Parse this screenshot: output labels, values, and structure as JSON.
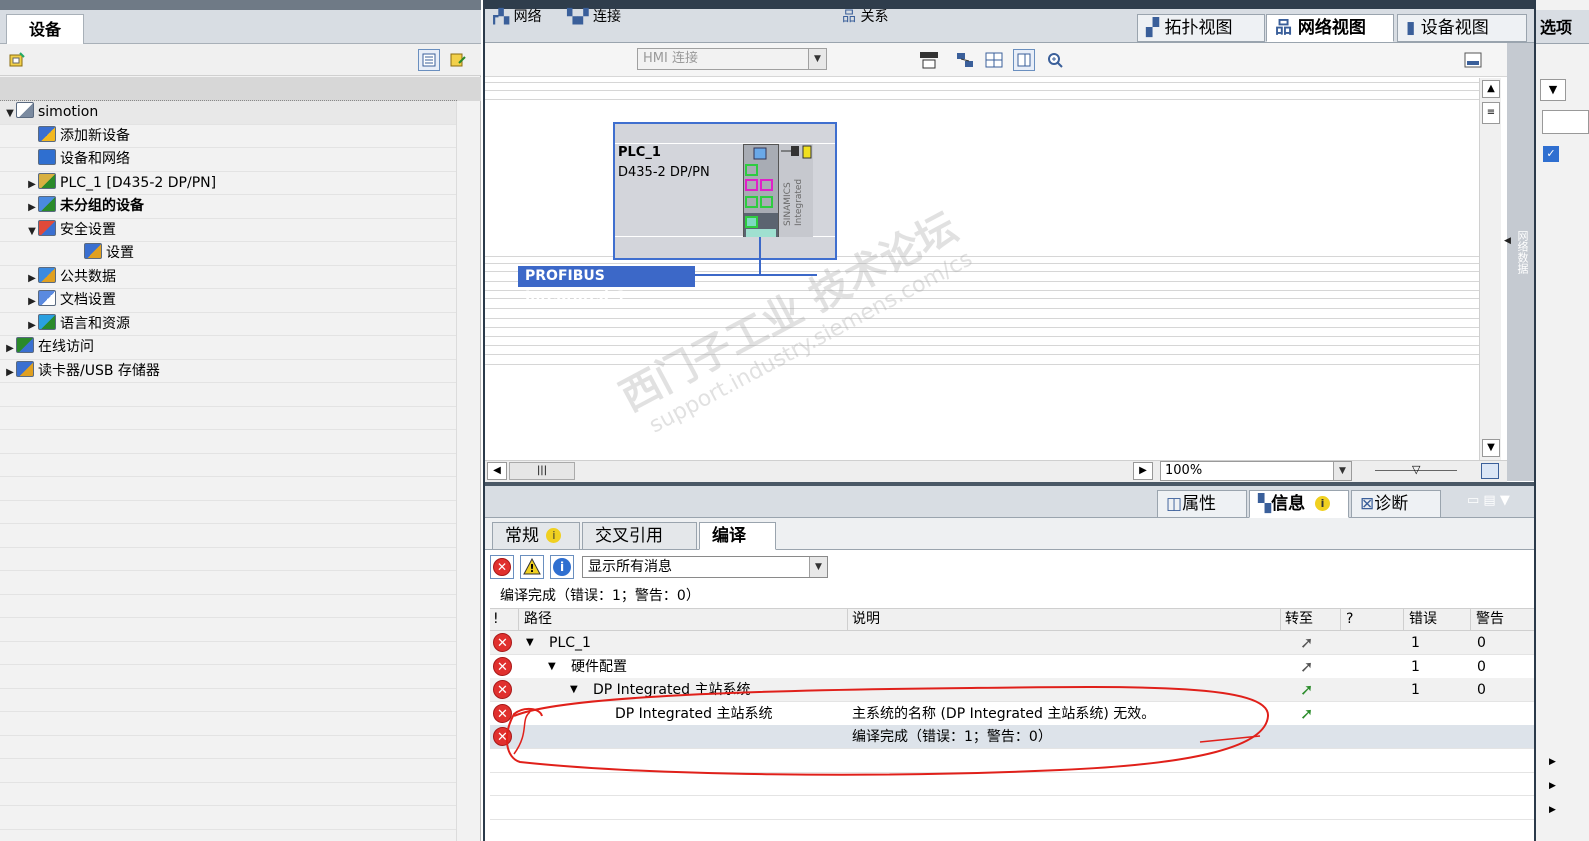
{
  "left_panel": {
    "tab_label": "设备",
    "tree": [
      {
        "label": "simotion",
        "indent": 0,
        "arrow": "▼",
        "bold": false,
        "icon": "project-icon"
      },
      {
        "label": "添加新设备",
        "indent": 1,
        "arrow": "",
        "bold": false,
        "icon": "add-device-icon"
      },
      {
        "label": "设备和网络",
        "indent": 1,
        "arrow": "",
        "bold": false,
        "icon": "network-icon"
      },
      {
        "label": "PLC_1 [D435-2 DP/PN]",
        "indent": 1,
        "arrow": "▶",
        "bold": false,
        "icon": "plc-icon"
      },
      {
        "label": "未分组的设备",
        "indent": 1,
        "arrow": "▶",
        "bold": true,
        "icon": "ungrouped-devices-icon"
      },
      {
        "label": "安全设置",
        "indent": 1,
        "arrow": "▼",
        "bold": false,
        "icon": "security-icon"
      },
      {
        "label": "设置",
        "indent": 2,
        "arrow": "",
        "bold": false,
        "icon": "settings-users-icon"
      },
      {
        "label": "公共数据",
        "indent": 1,
        "arrow": "▶",
        "bold": false,
        "icon": "common-data-icon"
      },
      {
        "label": "文档设置",
        "indent": 1,
        "arrow": "▶",
        "bold": false,
        "icon": "document-settings-icon"
      },
      {
        "label": "语言和资源",
        "indent": 1,
        "arrow": "▶",
        "bold": false,
        "icon": "languages-icon"
      },
      {
        "label": "在线访问",
        "indent": 0,
        "arrow": "▶",
        "bold": false,
        "icon": "online-access-icon"
      },
      {
        "label": "读卡器/USB 存储器",
        "indent": 0,
        "arrow": "▶",
        "bold": false,
        "icon": "card-reader-icon"
      }
    ]
  },
  "view_tabs": {
    "topology": "拓扑视图",
    "network": "网络视图",
    "device": "设备视图"
  },
  "network_toolbar": {
    "network": "网络",
    "connections": "连接",
    "hmi_connection": "HMI 连接",
    "relations": "关系",
    "zoom": "100%"
  },
  "canvas": {
    "device_name": "PLC_1",
    "device_type": "D435-2 DP/PN",
    "card_label": "SINAMICS Integrated",
    "bus_label": "PROFIBUS Integrated_1",
    "side_label": "网络数据",
    "watermark_1": "西门子工业 技术论坛",
    "watermark_2": "support.industry.siemens.com/cs"
  },
  "inspector": {
    "tabs": {
      "properties": "属性",
      "info": "信息",
      "diagnostics": "诊断"
    },
    "subtabs": {
      "general": "常规",
      "cross_ref": "交叉引用",
      "compile": "编译"
    },
    "filter_value": "显示所有消息",
    "summary": "编译完成（错误：1；警告：0）",
    "columns": {
      "bang": "!",
      "path": "路径",
      "desc": "说明",
      "goto": "转至",
      "q": "?",
      "errors": "错误",
      "warnings": "警告"
    },
    "rows": [
      {
        "path": "PLC_1",
        "indent": 0,
        "arrow": "▼",
        "desc": "",
        "goto": "gray",
        "errors": "1",
        "warnings": "0"
      },
      {
        "path": "硬件配置",
        "indent": 1,
        "arrow": "▼",
        "desc": "",
        "goto": "gray",
        "errors": "1",
        "warnings": "0"
      },
      {
        "path": "DP Integrated 主站系统",
        "indent": 2,
        "arrow": "▼",
        "desc": "",
        "goto": "green",
        "errors": "1",
        "warnings": "0"
      },
      {
        "path": "DP Integrated 主站系统",
        "indent": 3,
        "arrow": "",
        "desc": "主系统的名称 (DP Integrated 主站系统) 无效。",
        "goto": "green",
        "errors": "",
        "warnings": ""
      },
      {
        "path": "",
        "indent": 0,
        "arrow": "",
        "desc": "编译完成（错误：1；警告：0）",
        "goto": "",
        "errors": "",
        "warnings": ""
      }
    ]
  },
  "right_panel": {
    "title": "选项"
  },
  "colors": {
    "accent_blue": "#3c68c8",
    "error_red": "#e0302e",
    "goto_green": "#2b8c2b",
    "annotation_red": "#e0201a"
  }
}
